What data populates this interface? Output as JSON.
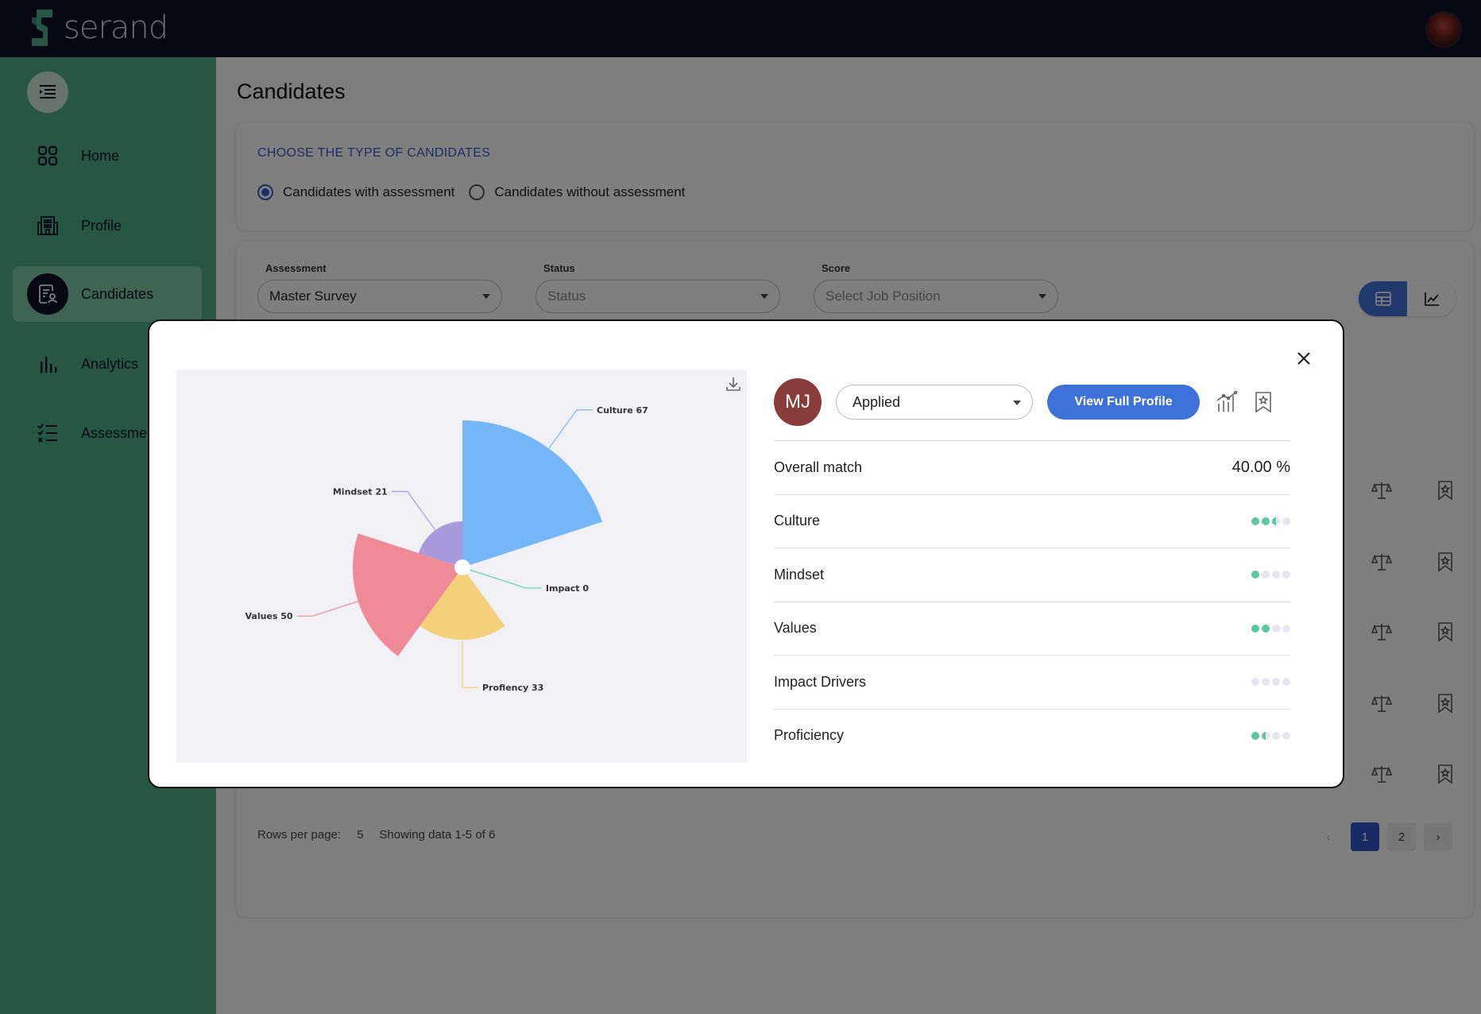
{
  "app": {
    "name": "serand"
  },
  "sidebar": {
    "items": [
      {
        "label": "Home",
        "icon": "grid-icon",
        "active": false
      },
      {
        "label": "Profile",
        "icon": "building-icon",
        "active": false
      },
      {
        "label": "Candidates",
        "icon": "candidates-icon",
        "active": true
      },
      {
        "label": "Analytics",
        "icon": "bar-chart-icon",
        "active": false
      },
      {
        "label": "Assessments",
        "icon": "checklist-icon",
        "active": false
      }
    ]
  },
  "page": {
    "title": "Candidates",
    "type_heading": "CHOOSE THE TYPE OF CANDIDATES",
    "radio_options": [
      {
        "label": "Candidates with assessment",
        "checked": true
      },
      {
        "label": "Candidates without assessment",
        "checked": false
      }
    ],
    "filters": {
      "assessment": {
        "label": "Assessment",
        "value": "Master Survey"
      },
      "status": {
        "label": "Status",
        "placeholder": "Status"
      },
      "score": {
        "label": "Score",
        "placeholder": "Select Job Position"
      }
    },
    "pagination": {
      "rows_per_page_label": "Rows per page:",
      "rows_per_page": "5",
      "showing": "Showing data 1-5 of 6",
      "pages": [
        "1",
        "2"
      ],
      "current": "1"
    }
  },
  "modal": {
    "avatar_initials": "MJ",
    "status_value": "Applied",
    "view_profile_label": "View Full Profile",
    "metrics": [
      {
        "label": "Overall match",
        "value": "40.00 %"
      },
      {
        "label": "Culture",
        "level": 2.5
      },
      {
        "label": "Mindset",
        "level": 1
      },
      {
        "label": "Values",
        "level": 2
      },
      {
        "label": "Impact Drivers",
        "level": 0
      },
      {
        "label": "Proficiency",
        "level": 1.5
      }
    ]
  },
  "chart_data": {
    "type": "pie",
    "subtype": "nightingale-rose",
    "categories": [
      "Culture",
      "Impact",
      "Proficiency",
      "Values",
      "Mindset"
    ],
    "values": [
      67,
      0,
      33,
      50,
      21
    ],
    "labels": [
      "Culture 67",
      "Impact 0",
      "Profiency 33",
      "Values 50",
      "Mindset 21"
    ],
    "colors": [
      "#74b6f6",
      "#5fd6b2",
      "#f5d07a",
      "#ee8b96",
      "#a99ade"
    ],
    "title": "",
    "xlabel": "",
    "ylabel": ""
  },
  "colors": {
    "topbar": "#0c1327",
    "sidebar": "#4fae89",
    "accent": "#3f72d9",
    "dot_full": "#59c8a2"
  }
}
